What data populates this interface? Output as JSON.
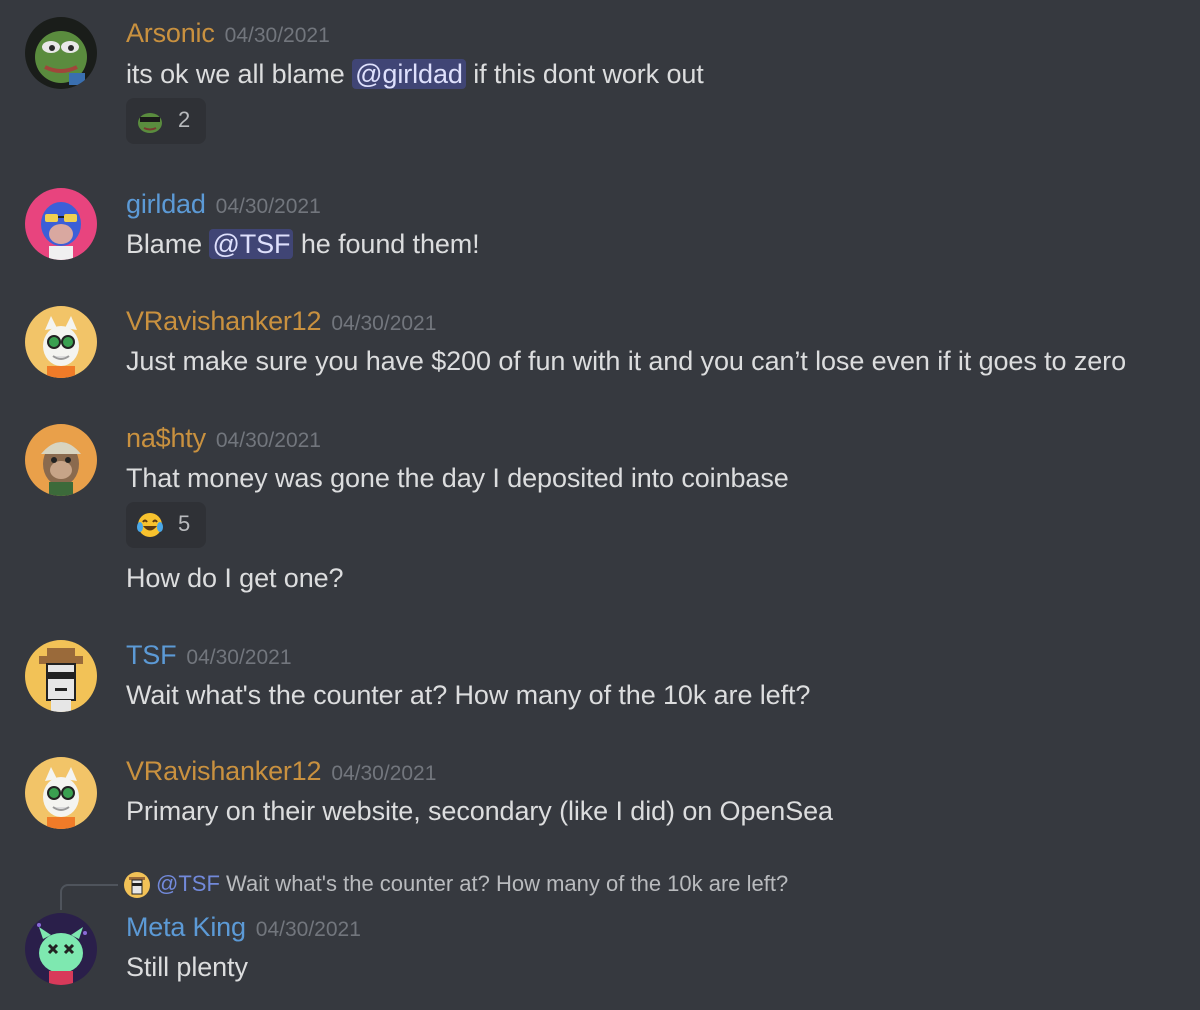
{
  "colors": {
    "background": "#36393f",
    "orange_name": "#c9913f",
    "blue_name": "#5c9ad6",
    "timestamp": "#72767d",
    "text": "#dcddde",
    "mention_bg": "#454b88"
  },
  "messages": [
    {
      "author": "Arsonic",
      "time": "04/30/2021",
      "avatar_icon": "pepe-avatar-icon",
      "text_before": "its ok we all blame",
      "mention": "@girldad",
      "text_after": "if this dont work out",
      "reaction": {
        "icon": "pepe-emoji-icon",
        "count": "2"
      }
    },
    {
      "author": "girldad",
      "time": "04/30/2021",
      "avatar_icon": "ape-avatar-icon",
      "text_before": "Blame",
      "mention": "@TSF",
      "text_after": "he found them!"
    },
    {
      "author": "VRavishanker12",
      "time": "04/30/2021",
      "avatar_icon": "cat-avatar-icon",
      "text": "Just make sure you have $200 of fun with it and you can’t lose even if it goes to zero"
    },
    {
      "author": "na$hty",
      "time": "04/30/2021",
      "avatar_icon": "ape-helmet-avatar-icon",
      "text": "That money was gone the day I deposited into coinbase",
      "reaction": {
        "icon": "tears-of-joy-emoji-icon",
        "count": "5"
      },
      "followup": "How do I get one?"
    },
    {
      "author": "TSF",
      "time": "04/30/2021",
      "avatar_icon": "punk-avatar-icon",
      "text": "Wait what's the counter at? How many of the 10k are left?"
    },
    {
      "author": "VRavishanker12",
      "time": "04/30/2021",
      "avatar_icon": "cat-avatar-icon",
      "text": "Primary on their website, secondary (like I did) on OpenSea"
    },
    {
      "author": "Meta King",
      "time": "04/30/2021",
      "avatar_icon": "alien-avatar-icon",
      "reply_mention": "@TSF",
      "reply_text": "Wait what's the counter at? How many of the 10k are left?",
      "text": "Still plenty"
    }
  ]
}
